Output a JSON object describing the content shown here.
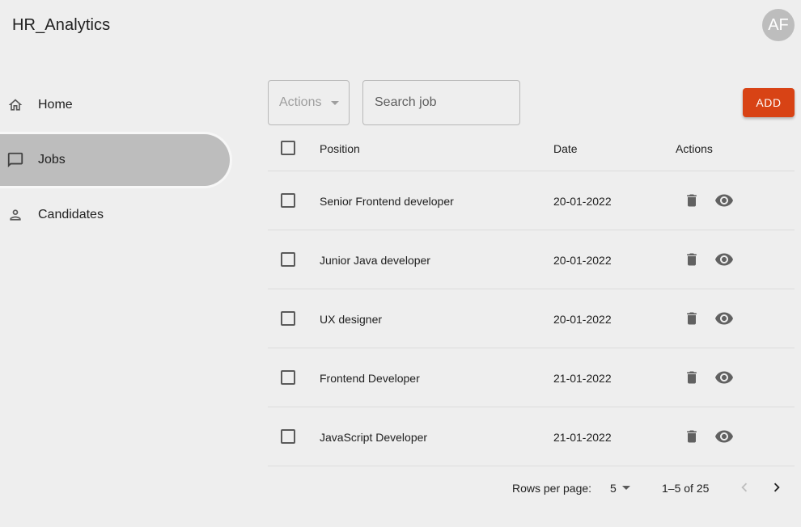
{
  "app": {
    "title": "HR_Analytics",
    "avatar_initials": "AF"
  },
  "sidebar": {
    "items": [
      {
        "label": "Home",
        "icon": "home-icon",
        "active": false
      },
      {
        "label": "Jobs",
        "icon": "chat-icon",
        "active": true
      },
      {
        "label": "Candidates",
        "icon": "person-icon",
        "active": false
      }
    ]
  },
  "toolbar": {
    "actions_placeholder": "Actions",
    "search_placeholder": "Search job",
    "add_label": "ADD"
  },
  "table": {
    "columns": [
      "Position",
      "Date",
      "Actions"
    ],
    "rows": [
      {
        "position": "Senior Frontend developer",
        "date": "20-01-2022"
      },
      {
        "position": "Junior Java developer",
        "date": "20-01-2022"
      },
      {
        "position": "UX designer",
        "date": "20-01-2022"
      },
      {
        "position": "Frontend Developer",
        "date": "21-01-2022"
      },
      {
        "position": "JavaScript Developer",
        "date": "21-01-2022"
      }
    ]
  },
  "pagination": {
    "rows_per_page_label": "Rows per page:",
    "rows_per_page_value": "5",
    "range_text": "1–5 of 25"
  },
  "colors": {
    "background": "#eeeeee",
    "accent": "#d84315",
    "active_nav": "#bdbdbd",
    "avatar": "#bdbdbd"
  }
}
